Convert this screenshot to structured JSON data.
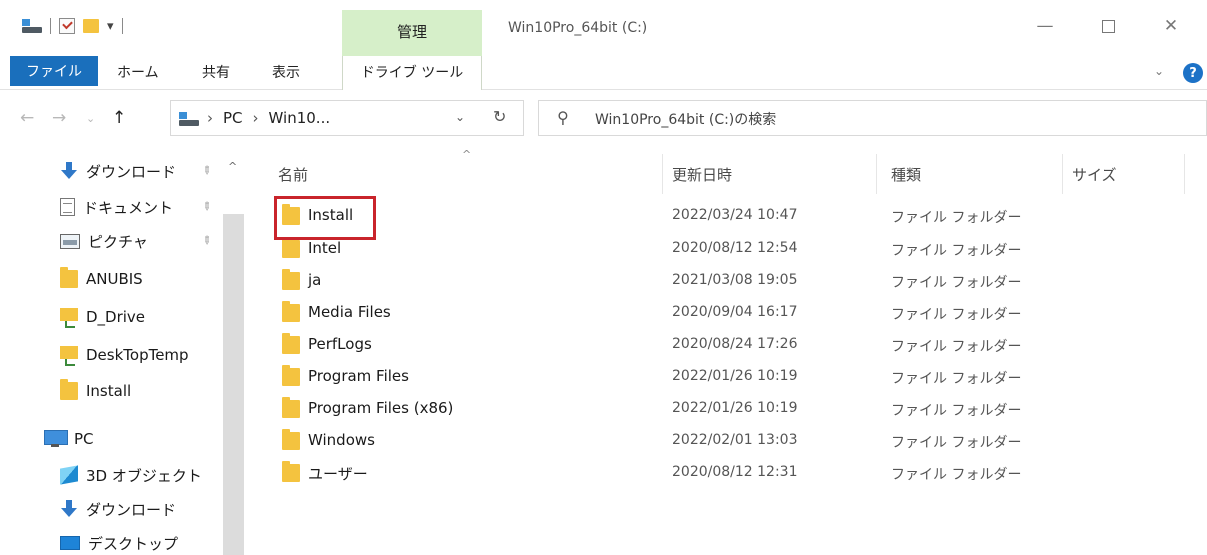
{
  "window": {
    "title": "Win10Pro_64bit (C:)",
    "manage_tab": "管理",
    "minimize_glyph": "—",
    "close_glyph": "✕"
  },
  "ribbon": {
    "tabs": [
      "ファイル",
      "ホーム",
      "共有",
      "表示"
    ],
    "drive_tools": "ドライブ ツール",
    "expand_glyph": "⌄",
    "help_glyph": "?"
  },
  "address": {
    "crumbs": [
      "PC",
      "Win10..."
    ],
    "search_placeholder": "Win10Pro_64bit (C:)の検索"
  },
  "nav_pane": {
    "items": [
      {
        "label": "ダウンロード",
        "icon": "download-icon",
        "pinned": true
      },
      {
        "label": "ドキュメント",
        "icon": "document-icon",
        "pinned": true
      },
      {
        "label": "ピクチャ",
        "icon": "pictures-icon",
        "pinned": true
      },
      {
        "label": "ANUBIS",
        "icon": "folder-icon",
        "pinned": false
      },
      {
        "label": "D_Drive",
        "icon": "network-folder-icon",
        "pinned": false
      },
      {
        "label": "DeskTopTemp",
        "icon": "network-folder-icon",
        "pinned": false
      },
      {
        "label": "Install",
        "icon": "folder-icon",
        "pinned": false
      },
      {
        "label": "PC",
        "icon": "pc-icon",
        "pinned": false
      },
      {
        "label": "3D オブジェクト",
        "icon": "3d-objects-icon",
        "pinned": false
      },
      {
        "label": "ダウンロード",
        "icon": "download-icon",
        "pinned": false
      },
      {
        "label": "デスクトップ",
        "icon": "desktop-icon",
        "pinned": false
      }
    ]
  },
  "file_list": {
    "columns": {
      "name": "名前",
      "date": "更新日時",
      "type": "種類",
      "size": "サイズ"
    },
    "rows": [
      {
        "name": "Install",
        "date": "2022/03/24 10:47",
        "type": "ファイル フォルダー"
      },
      {
        "name": "Intel",
        "date": "2020/08/12 12:54",
        "type": "ファイル フォルダー"
      },
      {
        "name": "ja",
        "date": "2021/03/08 19:05",
        "type": "ファイル フォルダー"
      },
      {
        "name": "Media Files",
        "date": "2020/09/04 16:17",
        "type": "ファイル フォルダー"
      },
      {
        "name": "PerfLogs",
        "date": "2020/08/24 17:26",
        "type": "ファイル フォルダー"
      },
      {
        "name": "Program Files",
        "date": "2022/01/26 10:19",
        "type": "ファイル フォルダー"
      },
      {
        "name": "Program Files (x86)",
        "date": "2022/01/26 10:19",
        "type": "ファイル フォルダー"
      },
      {
        "name": "Windows",
        "date": "2022/02/01 13:03",
        "type": "ファイル フォルダー"
      },
      {
        "name": "ユーザー",
        "date": "2020/08/12 12:31",
        "type": "ファイル フォルダー"
      }
    ]
  },
  "colors": {
    "accent": "#1a6fbc",
    "manage_tab_bg": "#d6efc9",
    "highlight_border": "#c9242b",
    "folder": "#f4c33f"
  }
}
